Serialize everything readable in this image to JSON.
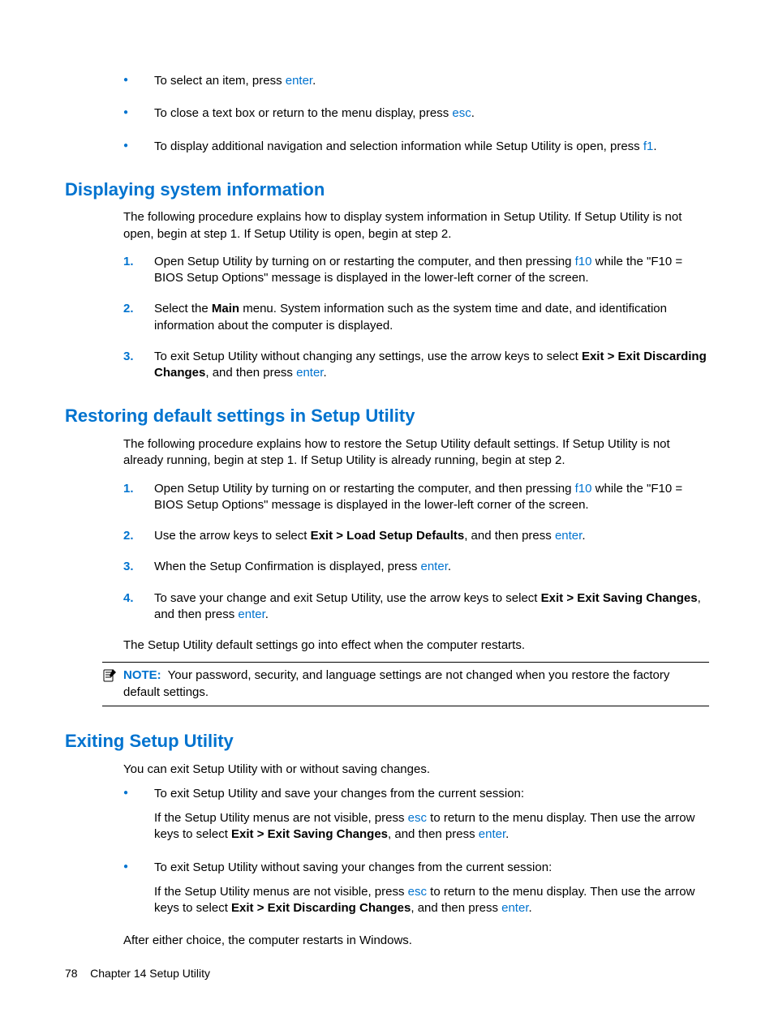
{
  "top_bullets": [
    {
      "pre": "To select an item, press ",
      "key": "enter",
      "post": "."
    },
    {
      "pre": "To close a text box or return to the menu display, press ",
      "key": "esc",
      "post": "."
    },
    {
      "pre": "To display additional navigation and selection information while Setup Utility is open, press ",
      "key": "f1",
      "post": "."
    }
  ],
  "section1": {
    "heading": "Displaying system information",
    "intro": "The following procedure explains how to display system information in Setup Utility. If Setup Utility is not open, begin at step 1. If Setup Utility is open, begin at step 2.",
    "steps": {
      "s1_pre": "Open Setup Utility by turning on or restarting the computer, and then pressing ",
      "s1_key": "f10",
      "s1_post": " while the \"F10 = BIOS Setup Options\" message is displayed in the lower-left corner of the screen.",
      "s2_pre": "Select the ",
      "s2_bold": "Main",
      "s2_post": " menu. System information such as the system time and date, and identification information about the computer is displayed.",
      "s3_pre": "To exit Setup Utility without changing any settings, use the arrow keys to select ",
      "s3_bold": "Exit > Exit Discarding Changes",
      "s3_mid": ", and then press ",
      "s3_key": "enter",
      "s3_post": "."
    }
  },
  "section2": {
    "heading": "Restoring default settings in Setup Utility",
    "intro": "The following procedure explains how to restore the Setup Utility default settings. If Setup Utility is not already running, begin at step 1. If Setup Utility is already running, begin at step 2.",
    "steps": {
      "s1_pre": "Open Setup Utility by turning on or restarting the computer, and then pressing ",
      "s1_key": "f10",
      "s1_post": " while the \"F10 = BIOS Setup Options\" message is displayed in the lower-left corner of the screen.",
      "s2_pre": "Use the arrow keys to select ",
      "s2_bold": "Exit > Load Setup Defaults",
      "s2_mid": ", and then press ",
      "s2_key": "enter",
      "s2_post": ".",
      "s3_pre": "When the Setup Confirmation is displayed, press ",
      "s3_key": "enter",
      "s3_post": ".",
      "s4_pre": "To save your change and exit Setup Utility, use the arrow keys to select ",
      "s4_bold": "Exit > Exit Saving Changes",
      "s4_mid": ", and then press ",
      "s4_key": "enter",
      "s4_post": "."
    },
    "after": "The Setup Utility default settings go into effect when the computer restarts.",
    "note_label": "NOTE:",
    "note_text": "Your password, security, and language settings are not changed when you restore the factory default settings."
  },
  "section3": {
    "heading": "Exiting Setup Utility",
    "intro": "You can exit Setup Utility with or without saving changes.",
    "b1": {
      "lead": "To exit Setup Utility and save your changes from the current session:",
      "pre": "If the Setup Utility menus are not visible, press ",
      "key1": "esc",
      "mid1": " to return to the menu display. Then use the arrow keys to select ",
      "bold": "Exit > Exit Saving Changes",
      "mid2": ", and then press ",
      "key2": "enter",
      "post": "."
    },
    "b2": {
      "lead": "To exit Setup Utility without saving your changes from the current session:",
      "pre": "If the Setup Utility menus are not visible, press ",
      "key1": "esc",
      "mid1": " to return to the menu display. Then use the arrow keys to select ",
      "bold": "Exit > Exit Discarding Changes",
      "mid2": ", and then press ",
      "key2": "enter",
      "post": "."
    },
    "after": "After either choice, the computer restarts in Windows."
  },
  "footer": {
    "page": "78",
    "chapter": "Chapter 14   Setup Utility"
  }
}
